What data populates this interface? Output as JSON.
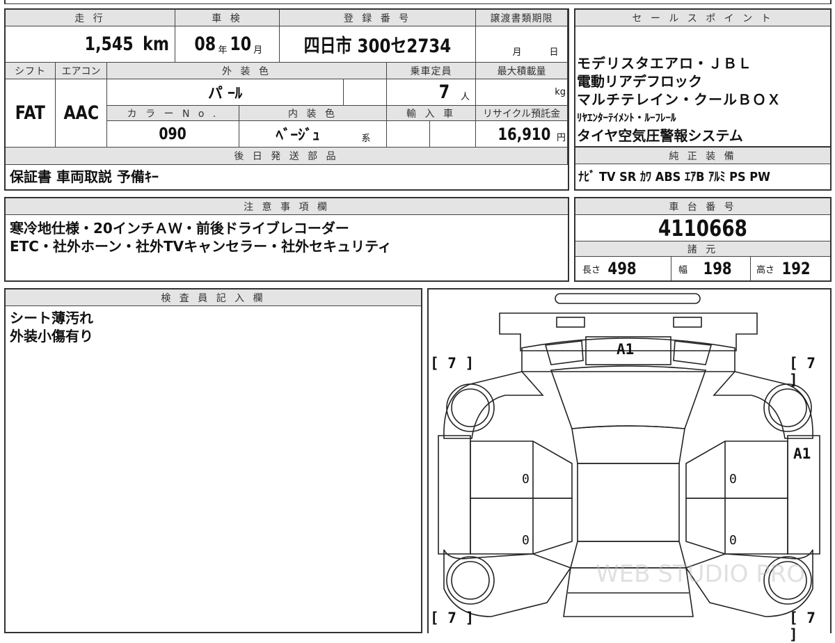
{
  "top": {
    "odometer": {
      "label": "走 行",
      "value": "1,545",
      "unit": "km"
    },
    "inspection": {
      "label": "車 検",
      "year": "08",
      "year_unit": "年",
      "month": "10",
      "month_unit": "月"
    },
    "registration": {
      "label": "登 録 番 号",
      "value": "四日市 300セ2734"
    },
    "transfer_deadline": {
      "label": "譲渡書類期限",
      "month_unit": "月",
      "day_unit": "日"
    },
    "shift": {
      "label": "シフト",
      "value": "FAT"
    },
    "aircon": {
      "label": "エアコン",
      "value": "AAC"
    },
    "exterior_color": {
      "label": "外 装 色",
      "value": "パ ｰﾙ"
    },
    "capacity": {
      "label": "乗車定員",
      "value": "7",
      "unit": "人"
    },
    "max_load": {
      "label": "最大積載量",
      "unit": "kg"
    },
    "color_no": {
      "label": "カ ラ ー N o .",
      "value": "090"
    },
    "interior_color": {
      "label": "内 装 色",
      "value": "ﾍﾞｰｼﾞｭ",
      "unit": "系"
    },
    "import": {
      "label": "輸 入 車"
    },
    "recycle_fee": {
      "label": "リサイクル預託金",
      "value": "16,910",
      "unit": "円"
    }
  },
  "later_parts": {
    "label": "後 日 発 送 部 品",
    "value": "保証書  車両取説  予備ｷｰ"
  },
  "sales_points": {
    "label": "セ ー ル ス ポ イ ン ト",
    "lines": [
      "モデリスタエアロ・ＪＢＬ",
      "電動リアデフロック",
      "マルチテレイン・クールＢＯＸ",
      "ﾘﾔｴﾝﾀｰﾃｲﾒﾝﾄ・ﾙｰﾌﾚｰﾙ",
      "タイヤ空気圧警報システム"
    ]
  },
  "genuine_equipment": {
    "label": "純 正 装 備",
    "value": "ﾅﾋﾞ  TV  SR  ｶﾜ  ABS  ｴｱB  ｱﾙﾐ  PS  PW"
  },
  "notes": {
    "label": "注 意 事 項 欄",
    "lines": [
      "寒冷地仕様・20インチＡＷ・前後ドライブレコーダー",
      "ETC・社外ホーン・社外TVキャンセラー・社外セキュリティ"
    ]
  },
  "chassis": {
    "label": "車 台 番 号",
    "value": "4110668"
  },
  "specs": {
    "label": "諸 元",
    "length_label": "長さ",
    "length": "498",
    "width_label": "幅",
    "width": "198",
    "height_label": "高さ",
    "height": "192"
  },
  "inspector": {
    "label": "検 査 員 記 入 欄",
    "lines": [
      "シート薄汚れ",
      "外装小傷有り"
    ]
  },
  "diagram": {
    "mark_front": "A1",
    "mark_side": "A1",
    "tire_front_left": "[ 7 ]",
    "tire_front_right": "[ 7 ]",
    "tire_rear_left": "[ 7 ]",
    "tire_rear_right": "[ 7 ]",
    "door_left_front": "0",
    "door_left_rear": "0",
    "door_right_front": "0",
    "door_right_rear": "0",
    "watermark": "WEB STUDIO PRO",
    "line_color": "#222222"
  }
}
